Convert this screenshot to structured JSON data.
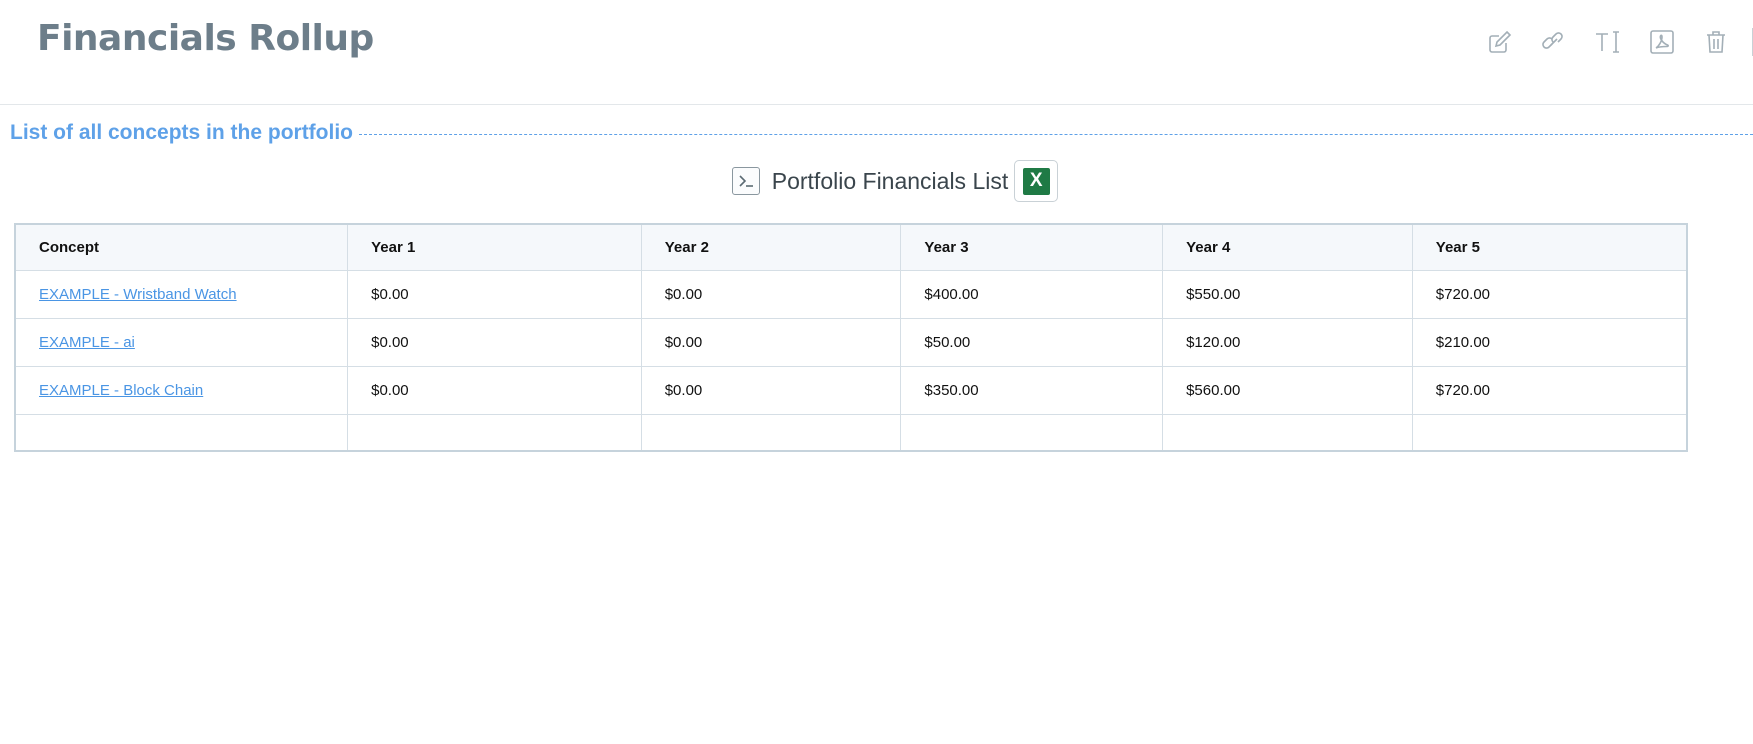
{
  "header": {
    "title": "Financials Rollup",
    "toolbar": [
      {
        "name": "edit",
        "icon": "edit-icon"
      },
      {
        "name": "link",
        "icon": "link-icon"
      },
      {
        "name": "text",
        "icon": "text-icon"
      },
      {
        "name": "pdf",
        "icon": "pdf-icon"
      },
      {
        "name": "delete",
        "icon": "trash-icon"
      }
    ]
  },
  "section": {
    "heading": "List of all concepts in the portfolio"
  },
  "list": {
    "title": "Portfolio Financials List",
    "excel_label": "X",
    "formula_icon": "formula-icon",
    "excel_icon": "excel-icon"
  },
  "table": {
    "columns": [
      "Concept",
      "Year 1",
      "Year 2",
      "Year 3",
      "Year 4",
      "Year 5"
    ],
    "rows": [
      {
        "concept": "EXAMPLE - Wristband Watch",
        "values": [
          "$0.00",
          "$0.00",
          "$400.00",
          "$550.00",
          "$720.00"
        ]
      },
      {
        "concept": "EXAMPLE - ai",
        "values": [
          "$0.00",
          "$0.00",
          "$50.00",
          "$120.00",
          "$210.00"
        ]
      },
      {
        "concept": "EXAMPLE - Block Chain",
        "values": [
          "$0.00",
          "$0.00",
          "$350.00",
          "$560.00",
          "$720.00"
        ]
      }
    ]
  },
  "colors": {
    "title": "#6d7e8a",
    "accent": "#5ea1e8",
    "link": "#4a95e4",
    "excel": "#1f7a45"
  }
}
